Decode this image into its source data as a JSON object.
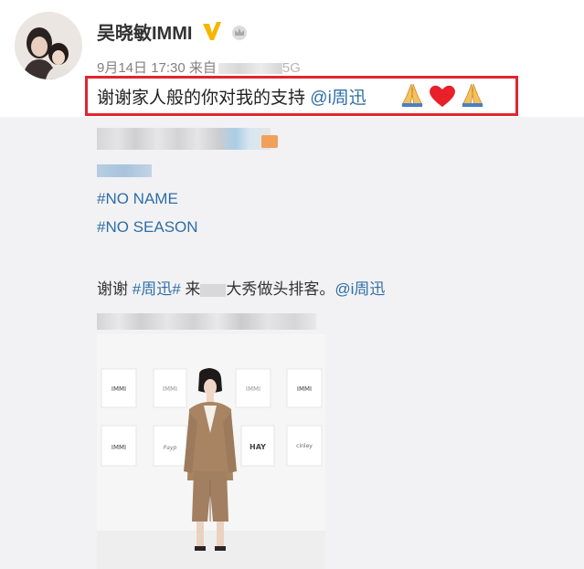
{
  "user": {
    "name": "吴晓敏IMMI"
  },
  "meta": {
    "datetime": "9月14日 17:30",
    "from_label": "来自",
    "source_tail": "5G"
  },
  "post": {
    "text": "谢谢家人般的你对我的支持 ",
    "mention": "@i周迅",
    "emojis": [
      "folded-hands-icon",
      "red-heart-icon",
      "folded-hands-icon"
    ]
  },
  "tags": [
    "#NO NAME",
    "#NO SEASON"
  ],
  "thanks": {
    "prefix": "谢谢 ",
    "topic": "#周迅#",
    "middle": " 来",
    "suffix": "大秀做头排客。",
    "mention": "@i周迅"
  },
  "photo": {
    "panels": [
      "IMMI",
      "IMMI",
      "IMMI",
      "IMMI",
      "IMMI",
      "Payp",
      "HAY",
      "cinley"
    ]
  },
  "colors": {
    "link": "#2f6ea5",
    "highlight": "#e0252e",
    "background": "#f2f2f5",
    "verified": "#f7b500"
  }
}
